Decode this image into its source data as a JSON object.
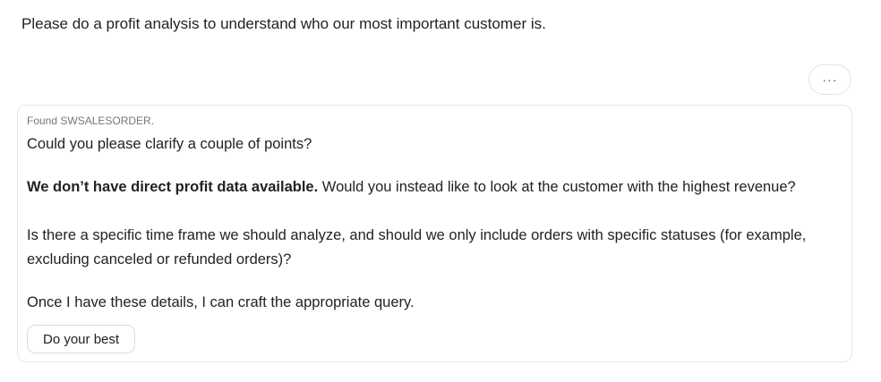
{
  "user_message": "Please do a profit analysis to understand who our most important customer is.",
  "more_button": "···",
  "response": {
    "status": "Found SWSALESORDER.",
    "intro": "Could you please clarify a couple of points?",
    "point1_bold": "We don’t have direct profit data available.",
    "point1_rest": " Would you instead like to look at the customer with the highest revenue?",
    "point2": "Is there a specific time frame we should analyze, and should we only include orders with specific statuses (for example, excluding canceled or refunded orders)?",
    "closing": "Once I have these details, I can craft the appropriate query.",
    "action_button": "Do your best"
  }
}
